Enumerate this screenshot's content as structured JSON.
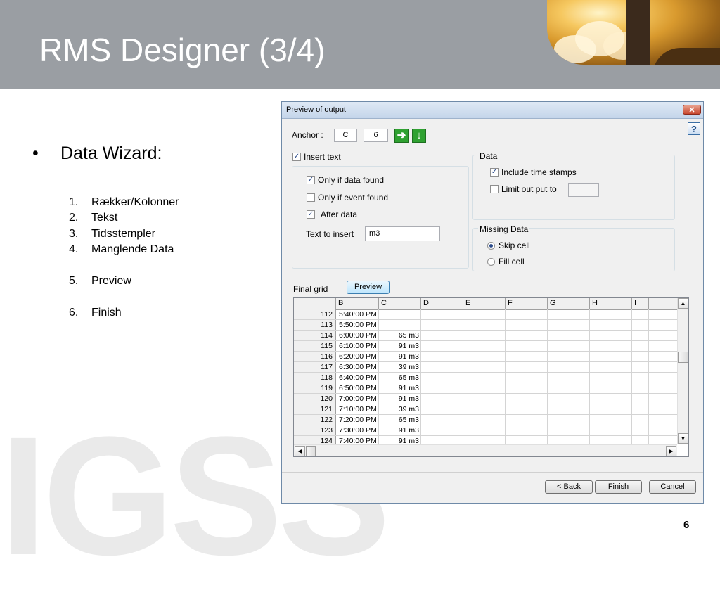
{
  "slide": {
    "title": "RMS Designer (3/4)",
    "bullet": "Data Wizard:",
    "steps": [
      {
        "num": "1.",
        "text": "Rækker/Kolonner"
      },
      {
        "num": "2.",
        "text": "Tekst"
      },
      {
        "num": "3.",
        "text": "Tidsstempler"
      },
      {
        "num": "4.",
        "text": "Manglende Data"
      },
      {
        "num": "5.",
        "text": "Preview"
      },
      {
        "num": "6.",
        "text": "Finish"
      }
    ],
    "watermark": "IGSS",
    "page_number": "6"
  },
  "dialog": {
    "title": "Preview of output",
    "close_label": "✕",
    "help_label": "?",
    "anchor": {
      "label": "Anchor :",
      "column": "C",
      "row": "6",
      "right_arrow": "➔",
      "down_arrow": "↓"
    },
    "insert_text": {
      "label": "Insert text",
      "checked": true,
      "only_if_data_found": {
        "label": "Only if data found",
        "checked": true
      },
      "only_if_event_found": {
        "label": "Only if event found",
        "checked": false
      },
      "after_data": {
        "label": "After data",
        "checked": true
      },
      "text_to_insert_label": "Text to insert",
      "text_to_insert_value": "m3"
    },
    "data_group": {
      "label": "Data",
      "include_time_stamps": {
        "label": "Include time stamps",
        "checked": true
      },
      "limit_output_to": {
        "label": "Limit out put to",
        "checked": false,
        "value": ""
      }
    },
    "missing_data": {
      "label": "Missing Data",
      "skip_cell": {
        "label": "Skip cell",
        "selected": true
      },
      "fill_cell": {
        "label": "Fill cell",
        "selected": false
      }
    },
    "final_grid": {
      "label": "Final grid",
      "preview_button": "Preview",
      "columns": [
        "",
        "B",
        "C",
        "D",
        "E",
        "F",
        "G",
        "H",
        "I"
      ],
      "rows": [
        {
          "n": "112",
          "b": "5:40:00 PM",
          "c": ""
        },
        {
          "n": "113",
          "b": "5:50:00 PM",
          "c": ""
        },
        {
          "n": "114",
          "b": "6:00:00 PM",
          "c": "65 m3"
        },
        {
          "n": "115",
          "b": "6:10:00 PM",
          "c": "91 m3"
        },
        {
          "n": "116",
          "b": "6:20:00 PM",
          "c": "91 m3"
        },
        {
          "n": "117",
          "b": "6:30:00 PM",
          "c": "39 m3"
        },
        {
          "n": "118",
          "b": "6:40:00 PM",
          "c": "65 m3"
        },
        {
          "n": "119",
          "b": "6:50:00 PM",
          "c": "91 m3"
        },
        {
          "n": "120",
          "b": "7:00:00 PM",
          "c": "91 m3"
        },
        {
          "n": "121",
          "b": "7:10:00 PM",
          "c": "39 m3"
        },
        {
          "n": "122",
          "b": "7:20:00 PM",
          "c": "65 m3"
        },
        {
          "n": "123",
          "b": "7:30:00 PM",
          "c": "91 m3"
        },
        {
          "n": "124",
          "b": "7:40:00 PM",
          "c": "91 m3"
        }
      ]
    },
    "buttons": {
      "back": "< Back",
      "finish": "Finish",
      "cancel": "Cancel"
    }
  },
  "colors": {
    "header_bg": "#9a9ea3",
    "dialog_bg": "#f0f0f0",
    "arrow_green": "#2fa131"
  }
}
